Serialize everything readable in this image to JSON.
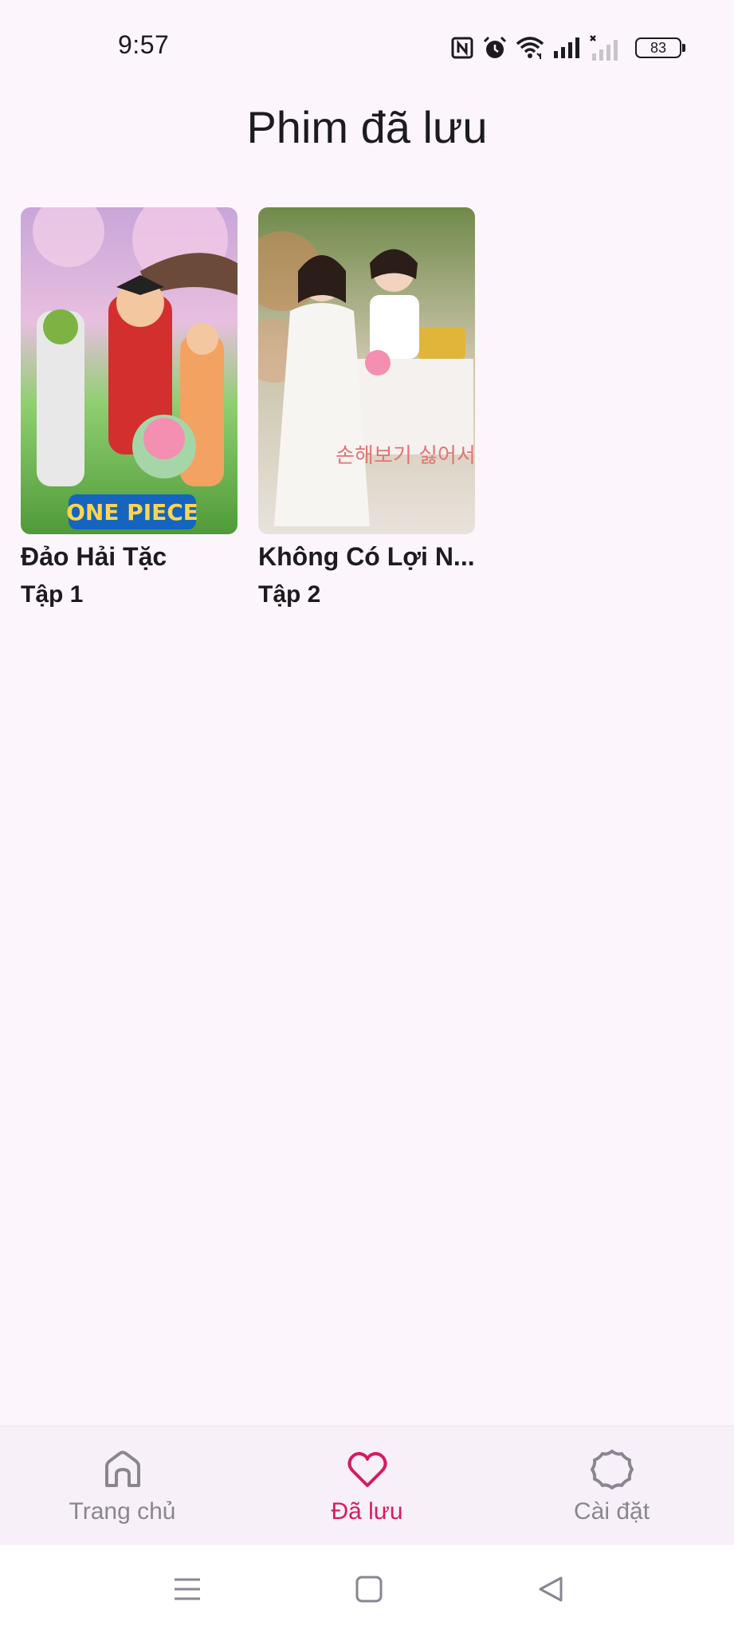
{
  "status_bar": {
    "time": "9:57",
    "battery": "83",
    "icons": [
      "nfc-icon",
      "alarm-icon",
      "wifi-icon",
      "signal-icon",
      "signal-off-icon",
      "battery-icon"
    ]
  },
  "page": {
    "title": "Phim đã lưu"
  },
  "movies": [
    {
      "title": "Đảo Hải Tặc",
      "episode": "Tập 1",
      "poster_logo": "ONE PIECE"
    },
    {
      "title": "Không Có Lợi N...",
      "episode": "Tập 2",
      "poster_logo": "손해보기 싫어서"
    }
  ],
  "bottom_nav": {
    "items": [
      {
        "label": "Trang chủ",
        "icon": "home-icon",
        "active": false
      },
      {
        "label": "Đã lưu",
        "icon": "heart-icon",
        "active": true
      },
      {
        "label": "Cài đặt",
        "icon": "settings-icon",
        "active": false
      }
    ]
  },
  "colors": {
    "accent": "#d81b60",
    "background": "#fcf6fc",
    "nav_inactive": "#8b8592"
  }
}
